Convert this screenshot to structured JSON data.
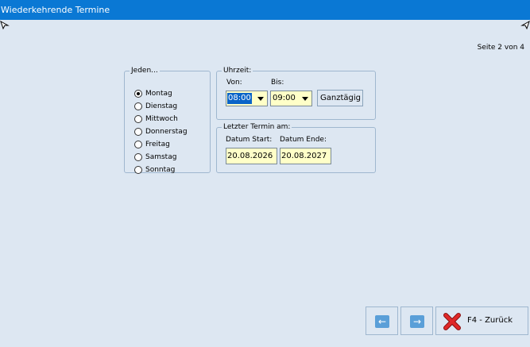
{
  "window": {
    "title": "Wiederkehrende Termine"
  },
  "page_info": "Seite 2 von 4",
  "jeden": {
    "legend": "Jeden...",
    "days": [
      "Montag",
      "Dienstag",
      "Mittwoch",
      "Donnerstag",
      "Freitag",
      "Samstag",
      "Sonntag"
    ],
    "selected": "Montag"
  },
  "uhrzeit": {
    "legend": "Uhrzeit:",
    "von_label": "Von:",
    "von_value": "08:00",
    "bis_label": "Bis:",
    "bis_value": "09:00",
    "ganztaegig_label": "Ganztägig"
  },
  "letzter": {
    "legend": "Letzter Termin am:",
    "start_label": "Datum Start:",
    "start_value": "20.08.2026",
    "end_label": "Datum Ende:",
    "end_value": "20.08.2027"
  },
  "footer": {
    "prev_icon": "arrow-left-icon",
    "next_icon": "arrow-right-icon",
    "back_icon": "red-x-icon",
    "back_label": "F4 - Zurück"
  }
}
